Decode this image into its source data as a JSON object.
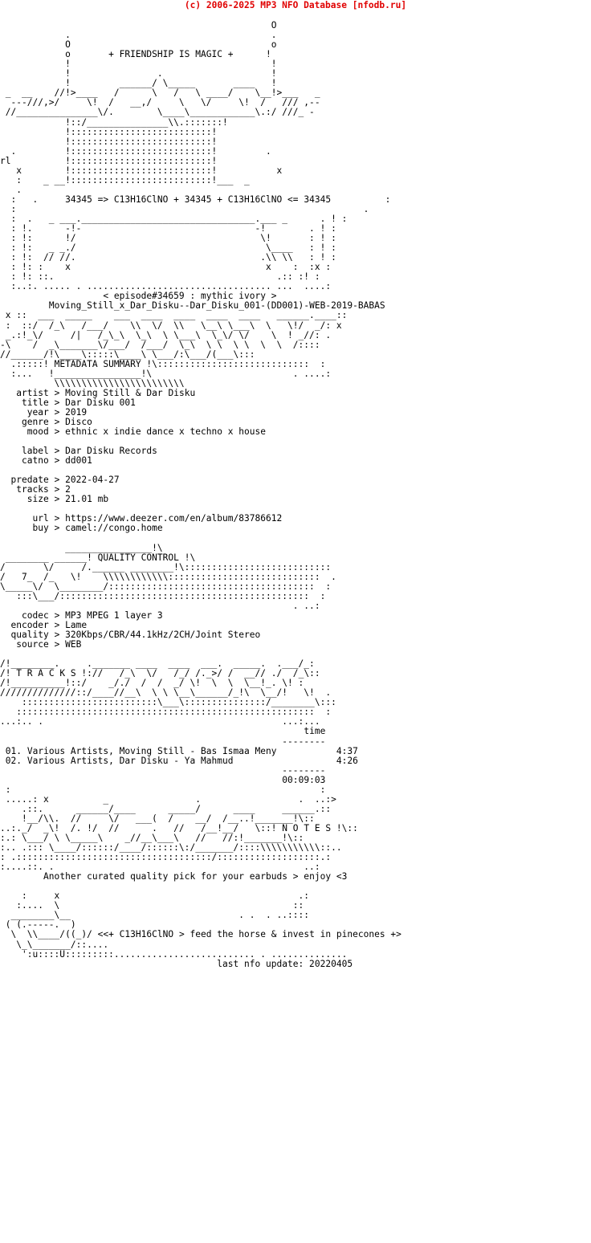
{
  "banner": {
    "text": "(c) 2006-2025 MP3 NFO Database [nfodb.ru]",
    "color": "#e00000"
  },
  "header": {
    "tagline": "+ FRIENDSHIP IS MAGIC +",
    "formula_line": "34345 => C13H16ClNO + 34345 + C13H16ClNO <= 34345",
    "episode": "< episode#34659 : mythic ivory >",
    "release": "Moving_Still_x_Dar_Disku--Dar_Disku_001-(DD001)-WEB-2019-BABAS"
  },
  "sections": {
    "metadata_summary_label": "METADATA SUMMARY",
    "quality_control_label": "QUALITY CONTROL",
    "tracks_label": "T R A C K S",
    "notes_label": "N O T E S"
  },
  "metadata": {
    "separator": ">",
    "groups": [
      [
        {
          "key": "artist",
          "value": "Moving Still & Dar Disku"
        },
        {
          "key": "title",
          "value": "Dar Disku 001"
        },
        {
          "key": "year",
          "value": "2019"
        },
        {
          "key": "genre",
          "value": "Disco"
        },
        {
          "key": "mood",
          "value": "ethnic x indie dance x techno x house"
        }
      ],
      [
        {
          "key": "label",
          "value": "Dar Disku Records"
        },
        {
          "key": "catno",
          "value": "dd001"
        }
      ],
      [
        {
          "key": "predate",
          "value": "2022-04-27"
        },
        {
          "key": "tracks",
          "value": "2"
        },
        {
          "key": "size",
          "value": "21.01 mb"
        }
      ],
      [
        {
          "key": "url",
          "value": "https://www.deezer.com/en/album/83786612"
        },
        {
          "key": "buy",
          "value": "camel://congo.home"
        }
      ]
    ]
  },
  "quality": {
    "separator": ">",
    "items": [
      {
        "key": "codec",
        "value": "MP3 MPEG 1 layer 3"
      },
      {
        "key": "encoder",
        "value": "Lame"
      },
      {
        "key": "quality",
        "value": "320Kbps/CBR/44.1kHz/2CH/Joint Stereo"
      },
      {
        "key": "source",
        "value": "WEB"
      }
    ]
  },
  "tracklist": {
    "time_header": "time",
    "rule": "--------",
    "rows": [
      {
        "num": "01.",
        "title": "Various Artists, Moving Still - Bas Ismaa Meny",
        "time": "4:37"
      },
      {
        "num": "02.",
        "title": "Various Artists, Dar Disku - Ya Mahmud",
        "time": "4:26"
      }
    ],
    "total": "00:09:03"
  },
  "notes": {
    "text": "Another curated quality pick for your earbuds > enjoy <3"
  },
  "footer": {
    "slogan": "<<+ C13H16ClNO > feed the horse & invest in pinecones +>",
    "last_update": "last nfo update: 20220405"
  },
  "art": {
    "banner_top": "                                                  O\n            .                                     .\n            O                                     o\n            o        + FRIENDSHIP IS MAGIC +      !\n            !                                     !",
    "logo_main": " _  __     //  ___!_____    _________/\\.        _______     _________/\\.   _________   .\n-- ---//,>___    \\>____/____/   \\    /  \\  ___>___    \\>____/  \\   ___|___/___/  ///,--- _\n   //    \\____\\!     /  /./      \\  /    \\/     \\____\\!   /    \\ /  \\_____/\\_/ //\n  /______________\\.:_/.     \\_____\\/      \\______________\\.:::::\\/_____/.:.__/\n              !::/______________________\\\\.::::::::::::::!\n              !:::::::::::::::::::::::::::::::::::::::::::!\n   .          !:::::::::::::::::::::::::::::::::::::::::::!          .\n rl  .        !:::::::::::::::::::::::::::::::::::::::::::!\n     x        !:::::::::::::::::::::::::::::::::::::::::::!          x\n     :    _ __!:::::::::::::::::::::::::::::::::::::::::::!___  _\n     .",
    "midframe": "  :                                                                          .\n  :   .     34345 => C13H16ClNO + 34345 + C13H16ClNO <= 34345              :\n  :                                                                        . :\n  :  .    _ ___.__________________________________________.___ _      . : :\n  : !.       -!-                                          -!        . ! :\n  : !:       !/                                           \\!        : ! :\n  : !:    _ _./                                            \\____    : ! :\n  : !:   // //.                                           .\\\\ \\\\    : ! :\n  : !: :     x                                              x    : :x :\n  : !: ::.                                                     .:: :! :\n  :..:. ..... . ............................................. ...  ....:",
    "meta_logo": " x ::  ___  _____    ___  ____  ____  ____  ____   ______._____::\n :  ::/  /_\\   /___/    \\\\  \\/  \\\\   \\__\\ \\___\\  \\   \\!/  _/: x\n _.:!_\\/     /|   /_\\_\\  \\_\\  \\ \\___\\  \\_\\/ \\/    \\  !  _//: .\n-\\    /  _\\_______\\/___/  /___/  \\_\\  \\ \\  \\ \\  \\  \\   /::::\n//______/!\\____\\:::::\\____\\ \\___/:\\___/(___\\:::\n  .:::::!  METADATA SUMMARY !\\:::::::::::::::::::::::::::::::  :\n  :...   !_________________!\\                            . ....:\n          \\\\\\\\\\\\\\\\\\\\\\\\\\\\\\\\\\\\\\\\",
    "qc_logo": "             ________________!\\\n  ________ ______!  QUALITY CONTROL !\\\n /       \\/     /.______ _________!\\:::::::::::::::::::::::::::::\n/   7_  /_   \\!     \\\\\\\\\\\\\\\\\\\\\\\\::::::::::::::::::::::::::::::  .\n\\_____\\/  \\_________/:::::::::::::::::::::::::::::::::::::::::  :\n   :::\\___/:::::::::::::::::::::::::::::::::::::::::::::::::::  :\n                                                          . ..:",
    "tracks_logo": "/!________.     ._______ ____  ____  ___.  _____.  .___/_:\n/! T R A C K S !://   /_\\  \\/   /_/ /._>/ /  __// ./  /_\\::\n/!__________!::/    _/./  /  /  _/ \\!  \\  \\  \\__!_. \\! :\n//////////////::/____//__\\  \\ \\ \\__\\______/_!\\  \\__/!   \\!  .\n    :::::::::::::::::::::::::\\___\\:::::::::::::::/________\\:::\n   :::::::::::::::::::::::::::::::::::::::::::::::::::::::  :\n...:.. .                                            ...:...",
    "notes_logo": " :                                                         :\n .....: x          _                .                  .  ..:>\n    .::.      ______/____      _____/      ____     ______.::\n    !__/\\\\.  //     \\/   ___(  /    __/  /__..!_______!\\::\n..:._/  _\\!  /. !/  //      .   //   /__!__/   \\::! N O T E S !\\::\n:.: \\___/ \\ \\_____\\    _//__\\___\\   //   //:!_______!\\::\n:.. .::: \\____/::::::/____/::::::\\:/_______/::::\\\\\\\\\\\\\\\\\\\\\\::..\n: .::::::::::::::::::::::::::::::::::::/:::::::::::::::::::.:\n:....::. .                                              ..:",
    "footer_logo": "    :     x                                            .:\n   :....  \\                                           ::\n  ________\\__                               . .  . ..::::\n ( (.-----.  )\n  \\  \\\\____/((_)/ "
  }
}
